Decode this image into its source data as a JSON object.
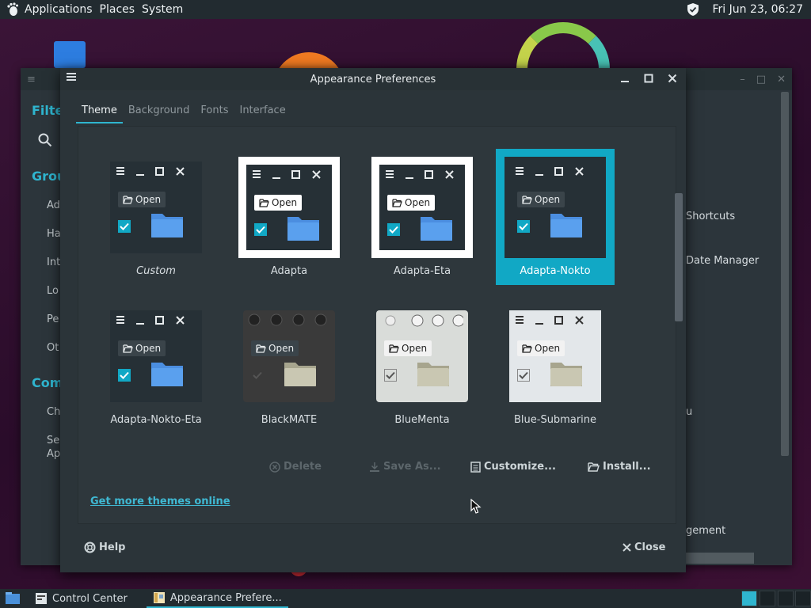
{
  "top_panel": {
    "menus": [
      "Applications",
      "Places",
      "System"
    ],
    "clock": "Fri Jun 23, 06:27"
  },
  "back_window": {
    "left_sections": [
      {
        "label": "Filter"
      },
      {
        "label": "Groups"
      },
      {
        "label": "Common"
      }
    ],
    "left_items": [
      "Ad",
      "Ha",
      "Int",
      "Lo",
      "Pe",
      "Ot",
      "Ch",
      "Se",
      "Ap"
    ],
    "right_items": [
      "Shortcuts",
      "Date Manager",
      "u",
      "gement"
    ]
  },
  "dialog": {
    "title": "Appearance Preferences",
    "tabs": [
      {
        "label": "Theme",
        "active": true
      },
      {
        "label": "Background",
        "active": false
      },
      {
        "label": "Fonts",
        "active": false
      },
      {
        "label": "Interface",
        "active": false
      }
    ],
    "themes": [
      {
        "name": "Custom",
        "style": "nokto",
        "italic": true
      },
      {
        "name": "Adapta",
        "style": "adapta"
      },
      {
        "name": "Adapta-Eta",
        "style": "adapta"
      },
      {
        "name": "Adapta-Nokto",
        "style": "nokto",
        "selected": true
      },
      {
        "name": "Adapta-Nokto-Eta",
        "style": "nokto"
      },
      {
        "name": "BlackMATE",
        "style": "blackmate"
      },
      {
        "name": "BlueMenta",
        "style": "bluementa"
      },
      {
        "name": "Blue-Submarine",
        "style": "submarine"
      }
    ],
    "thumb_open_label": "Open",
    "actions": {
      "delete": "Delete",
      "save_as": "Save As...",
      "customize": "Customize...",
      "install": "Install..."
    },
    "more_link": "Get more themes online",
    "help": "Help",
    "close": "Close"
  },
  "taskbar": {
    "tasks": [
      {
        "label": "Control Center",
        "active": false
      },
      {
        "label": "Appearance Prefere...",
        "active": true
      }
    ]
  },
  "colors": {
    "accent": "#11a8c5",
    "panel": "#222b30",
    "dialog_bg": "#2b3439"
  }
}
